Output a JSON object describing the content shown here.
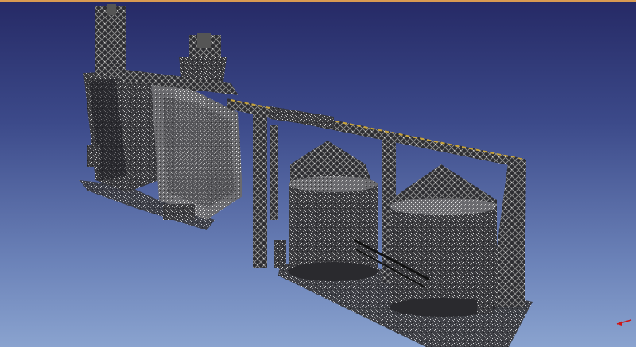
{
  "viewer": {
    "scene_name": "point-cloud-grain-elevator",
    "colors": {
      "background_top": "#262a66",
      "background_bottom": "#8aa3cf",
      "window_border": "#d89a52",
      "points_dark": "#2a2a2e",
      "points_mid": "#6d6d70",
      "points_light": "#b9b9b9",
      "highlight_yellow": "#c9a43a",
      "axis_red": "#d01515"
    },
    "icons": [
      "axis-indicator-icon"
    ]
  }
}
